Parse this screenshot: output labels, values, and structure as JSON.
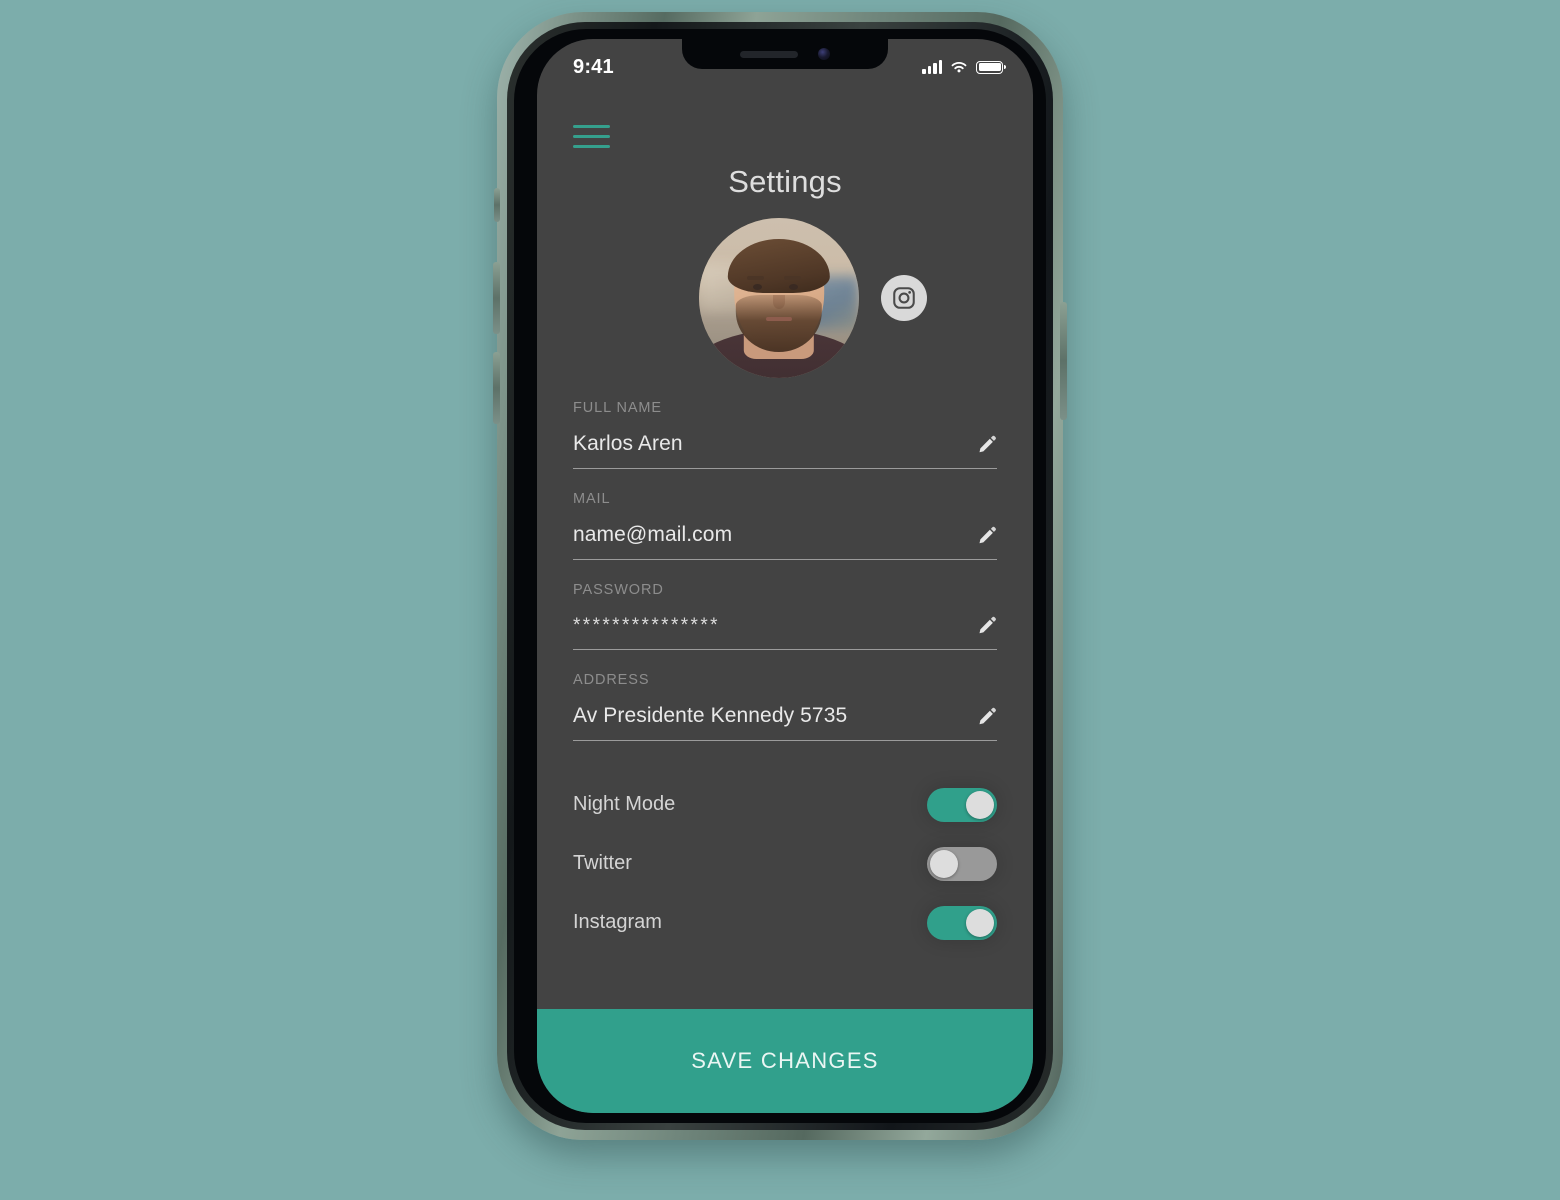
{
  "theme": {
    "page_background": "#7cadab",
    "screen_background": "#434343",
    "accent": "#31a08c",
    "toggle_off": "#999999",
    "label_color": "#8d8d8d",
    "value_color": "#e9e9e9"
  },
  "status_bar": {
    "time": "9:41",
    "signal_icon": "cellular-signal-icon",
    "wifi_icon": "wifi-icon",
    "battery_icon": "battery-full-icon"
  },
  "header": {
    "menu_icon": "hamburger-menu-icon",
    "title": "Settings"
  },
  "profile": {
    "avatar_alt": "user-avatar",
    "badge_icon": "instagram-icon"
  },
  "form": {
    "fields": [
      {
        "label": "FULL NAME",
        "value": "Karlos Aren",
        "edit_icon": "pencil-icon",
        "masked": false
      },
      {
        "label": "MAIL",
        "value": "name@mail.com",
        "edit_icon": "pencil-icon",
        "masked": false
      },
      {
        "label": "PASSWORD",
        "value": "***************",
        "edit_icon": "pencil-icon",
        "masked": true
      },
      {
        "label": "ADDRESS",
        "value": "Av Presidente Kennedy 5735",
        "edit_icon": "pencil-icon",
        "masked": false
      }
    ]
  },
  "toggles": [
    {
      "label": "Night Mode",
      "state": "on"
    },
    {
      "label": "Twitter",
      "state": "off"
    },
    {
      "label": "Instagram",
      "state": "on"
    }
  ],
  "footer": {
    "save_label": "SAVE CHANGES"
  }
}
